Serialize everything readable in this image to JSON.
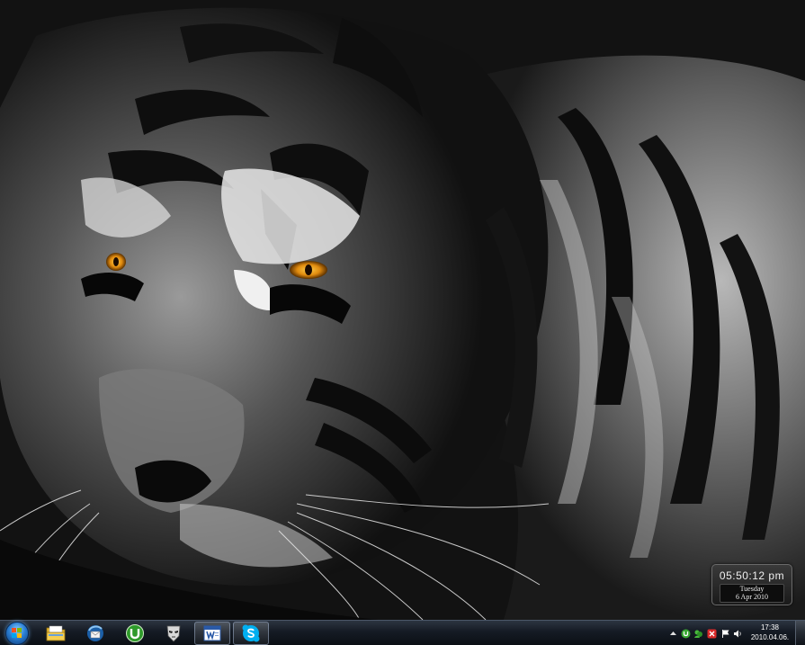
{
  "desktop": {
    "wallpaper_icon": "tiger-wallpaper"
  },
  "clock_gadget": {
    "time": "05:50:12 pm",
    "weekday": "Tuesday",
    "date": "6 Apr 2010"
  },
  "taskbar": {
    "start_icon": "windows-start-orb",
    "pinned": [
      {
        "name": "file-explorer",
        "icon": "folder-icon"
      },
      {
        "name": "thunderbird",
        "icon": "thunderbird-icon"
      },
      {
        "name": "utorrent",
        "icon": "utorrent-icon"
      },
      {
        "name": "app-mask",
        "icon": "mask-icon"
      },
      {
        "name": "word",
        "icon": "word-icon"
      },
      {
        "name": "skype",
        "icon": "skype-icon"
      }
    ],
    "tray": {
      "icons": [
        "show-hidden-icons-arrow",
        "utorrent-tray-icon",
        "messenger-tray-icon",
        "antivirus-tray-icon",
        "action-center-flag-icon",
        "volume-icon"
      ],
      "time": "17:38",
      "date": "2010.04.06."
    }
  }
}
